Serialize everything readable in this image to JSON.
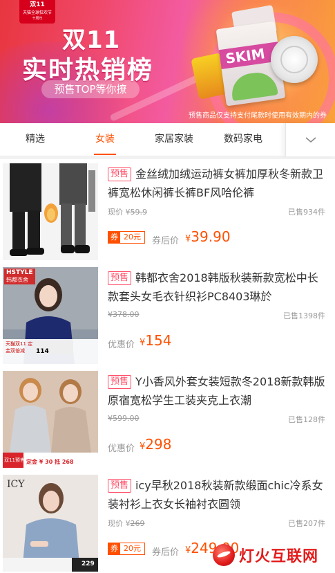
{
  "banner": {
    "badge_logo": "双11",
    "badge_line1": "天猫全球狂欢节",
    "badge_line2": "十周年",
    "title1": "双11",
    "title2": "实时热销榜",
    "pill": "预售TOP等你撩",
    "note": "预售商品仅支持支付尾款时使用有效期内的券",
    "bag_text": "SKIM"
  },
  "tabs": [
    {
      "label": "精选",
      "active": false
    },
    {
      "label": "女装",
      "active": true
    },
    {
      "label": "家居家装",
      "active": false
    },
    {
      "label": "数码家电",
      "active": false
    }
  ],
  "items": [
    {
      "tag": "预售",
      "title": "金丝绒加绒运动裤女裤加厚秋冬新款卫裤宽松休闲裤长裤BF风哈伦裤",
      "price_label": "现价 ¥",
      "old_price": "59.9",
      "sold": "已售934件",
      "coupon_prefix": "券",
      "coupon_value": "20元",
      "final_label": "券后价",
      "final_currency": "¥",
      "final_price": "39.90"
    },
    {
      "tag": "预售",
      "title": "韩都衣舍2018韩版秋装新款宽松中长款套头女毛衣针织衫PC8403琳於",
      "price_label": "",
      "old_price": "¥378.00",
      "sold": "已售1398件",
      "final_label": "优惠价",
      "final_currency": "¥",
      "final_price": "154",
      "thumb_brand": "HSTYLE",
      "thumb_brand_sub": "韩都衣舍",
      "thumb_promo": "天猫双11 定金双倍减",
      "thumb_promo_price": "114"
    },
    {
      "tag": "预售",
      "title": "Y小香风外套女装短款冬2018新款韩版原宿宽松学生工装夹克上衣潮",
      "price_label": "",
      "old_price": "¥599.00",
      "sold": "已售128件",
      "final_label": "优惠价",
      "final_currency": "¥",
      "final_price": "298",
      "thumb_promo": "双11预售",
      "thumb_promo_line": "定金 ¥ 30 抵 268"
    },
    {
      "tag": "预售",
      "title": "icy早秋2018秋装新款缎面chic冷系女装衬衫上衣女长袖衬衣圆领",
      "price_label": "现价 ¥",
      "old_price": "269",
      "sold": "已售207件",
      "coupon_prefix": "券",
      "coupon_value": "20元",
      "final_label": "券后价",
      "final_currency": "¥",
      "final_price": "249.00",
      "thumb_brand": "ICY",
      "thumb_price": "229"
    }
  ],
  "watermark": "灯火互联网",
  "colors": {
    "accent": "#ff5000",
    "tag": "#ff4d66",
    "muted": "#999999",
    "text": "#333333"
  },
  "icons": {
    "tab_more": "chevron-down-icon"
  }
}
